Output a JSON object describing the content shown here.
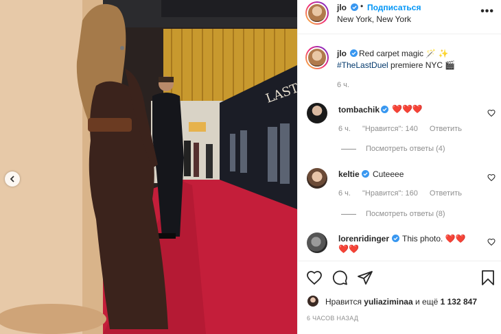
{
  "post": {
    "username": "jlo",
    "follow_label": "Подписаться",
    "separator": "•",
    "location": "New York, New York",
    "more_label": "•••",
    "caption_text": "Red carpet magic 🪄 ✨",
    "caption_tag": "#TheLastDuel",
    "caption_tail": " premiere NYC 🎬",
    "caption_time": "6 ч."
  },
  "comments": [
    {
      "username": "tombachik",
      "text": "❤️❤️❤️",
      "time": "6 ч.",
      "likes": "\"Нравится\": 140",
      "reply": "Ответить",
      "view_replies": "Посмотреть ответы (4)"
    },
    {
      "username": "keltie",
      "text": "Cuteeee",
      "time": "6 ч.",
      "likes": "\"Нравится\": 160",
      "reply": "Ответить",
      "view_replies": "Посмотреть ответы (8)"
    },
    {
      "username": "lorenridinger",
      "text": "This photo. ❤️❤️",
      "text_line2": "❤️❤️"
    }
  ],
  "likes": {
    "prefix": "Нравится ",
    "user": "yuliaziminaa",
    "middle": " и ещё ",
    "count": "1 132 847"
  },
  "post_time": "6 ЧАСОВ НАЗАД",
  "icons": {
    "verified": "verified-badge-icon",
    "like": "heart-icon",
    "comment": "comment-icon",
    "share": "share-icon",
    "save": "bookmark-icon",
    "prev": "chevron-left-icon"
  },
  "colors": {
    "link": "#0095f6",
    "hashtag": "#00376b",
    "muted": "#8e8e8e",
    "carpet": "#c41e3a"
  }
}
